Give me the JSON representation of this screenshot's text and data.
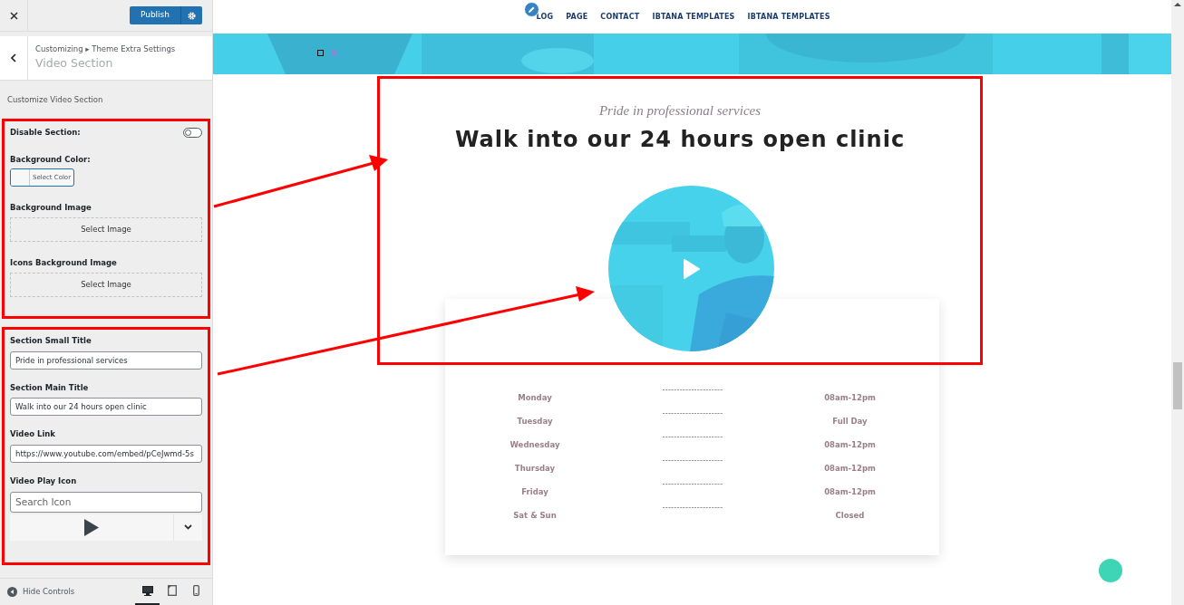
{
  "customizer": {
    "publish_button": "Publish",
    "breadcrumb": "Customizing ▸ Theme Extra Settings",
    "section_title": "Video Section",
    "description": "Customize Video Section",
    "groups": [
      {
        "highlighted": true,
        "controls": [
          {
            "kind": "toggle",
            "label": "Disable Section:",
            "on": false
          },
          {
            "kind": "color",
            "label": "Background Color:",
            "button": "Select Color"
          },
          {
            "label": "Background Image",
            "button": "Select Image"
          },
          {
            "label": "Icons Background Image",
            "button": "Select Image"
          }
        ]
      },
      {
        "highlighted": true,
        "controls": [
          {
            "kind": "text",
            "label": "Section Small Title",
            "value": "Pride in professional services"
          },
          {
            "kind": "text",
            "label": "Section Main Title",
            "value": "Walk into our 24 hours open clinic"
          },
          {
            "kind": "text",
            "label": "Video Link",
            "value": "https://www.youtube.com/embed/pCeJwmd-5s"
          },
          {
            "kind": "icon_picker",
            "label": "Video Play Icon",
            "placeholder": "Search Icon"
          }
        ]
      }
    ],
    "footer": {
      "hide_controls": "Hide Controls",
      "devices": [
        {
          "kind": "desktop",
          "selected": true
        },
        {
          "kind": "tablet",
          "selected": false
        },
        {
          "kind": "mobile",
          "selected": false
        }
      ]
    }
  },
  "preview": {
    "nav": [
      "LOG",
      "PAGE",
      "CONTACT",
      "IBTANA TEMPLATES",
      "IBTANA TEMPLATES"
    ],
    "slider_dots": [
      {
        "selected": true
      },
      {
        "selected": false
      }
    ],
    "highlighted": true,
    "small_title": "Pride in professional services",
    "main_title": "Walk into our 24 hours open clinic",
    "hours": [
      {
        "day": "Monday",
        "separator": "---------------------",
        "time": "08am-12pm"
      },
      {
        "day": "Tuesday",
        "separator": "---------------------",
        "time": "Full Day"
      },
      {
        "day": "Wednesday",
        "separator": "---------------------",
        "time": "08am-12pm"
      },
      {
        "day": "Thursday",
        "separator": "---------------------",
        "time": "08am-12pm"
      },
      {
        "day": "Friday",
        "separator": "---------------------",
        "time": "08am-12pm"
      },
      {
        "day": "Sat & Sun",
        "separator": "---------------------",
        "time": "Closed"
      }
    ]
  }
}
